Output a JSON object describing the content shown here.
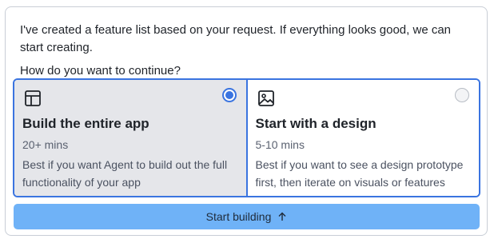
{
  "message": {
    "intro": "I've created a feature list based on your request. If everything looks good, we can start creating.",
    "question": "How do you want to continue?"
  },
  "options": [
    {
      "title": "Build the entire app",
      "time": "20+ mins",
      "description": "Best if you want Agent to build out the full functionality of your app",
      "icon": "layout-icon",
      "selected": true
    },
    {
      "title": "Start with a design",
      "time": "5-10 mins",
      "description": "Best if you want to see a design prototype first, then iterate on visuals or features",
      "icon": "image-icon",
      "selected": false
    }
  ],
  "action": {
    "label": "Start building",
    "icon": "arrow-up-icon"
  },
  "colors": {
    "accent": "#3a74e0",
    "button_bg": "#6fb2f7",
    "selected_bg": "#e5e6ea"
  }
}
